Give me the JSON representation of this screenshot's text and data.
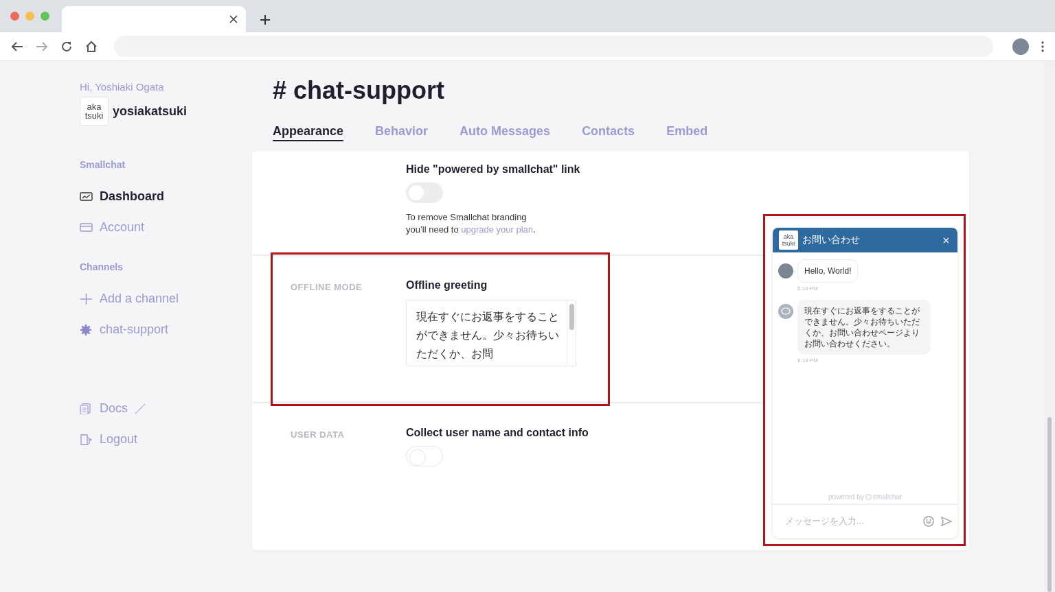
{
  "sidebar": {
    "greeting": "Hi, Yoshiaki Ogata",
    "logo_lines": [
      "aka",
      "tsuki"
    ],
    "workspace": "yosiakatsuki",
    "sections": [
      {
        "heading": "Smallchat",
        "items": [
          {
            "label": "Dashboard",
            "kind": "dashboard",
            "selected": true
          },
          {
            "label": "Account",
            "kind": "account",
            "selected": false
          }
        ]
      },
      {
        "heading": "Channels",
        "items": [
          {
            "label": "Add a channel",
            "kind": "add",
            "selected": false
          },
          {
            "label": "chat-support",
            "kind": "channel",
            "selected": false
          }
        ]
      },
      {
        "items": [
          {
            "label": "Docs",
            "kind": "docs",
            "selected": false
          },
          {
            "label": "Logout",
            "kind": "logout",
            "selected": false
          }
        ]
      }
    ]
  },
  "page": {
    "title": "# chat-support",
    "tabs": [
      {
        "label": "Appearance",
        "selected": true
      },
      {
        "label": "Behavior",
        "selected": false
      },
      {
        "label": "Auto Messages",
        "selected": false
      },
      {
        "label": "Contacts",
        "selected": false
      },
      {
        "label": "Embed",
        "selected": false
      }
    ]
  },
  "settings": [
    {
      "kind": "toggle",
      "title": "Hide \"powered by smallchat\" link",
      "on": false,
      "note": "To remove Smallchat branding you’ll need to",
      "note_link": "upgrade your plan",
      "note_end": "."
    },
    {
      "kind": "textarea",
      "section": "OFFLINE MODE",
      "title": "Offline greeting",
      "value": "現在すぐにお返事をすることができません。少々お待ちいただくか、お問"
    },
    {
      "kind": "toggle",
      "section": "USER DATA",
      "title": "Collect user name and contact info",
      "on": false
    }
  ],
  "chat_preview": {
    "title": "お問い合わせ",
    "logo_lines": [
      "aka",
      "tsuki"
    ],
    "messages": [
      {
        "kind": "user",
        "text": "Hello, World!",
        "time": "6:14 PM"
      },
      {
        "kind": "bot",
        "text": "現在すぐにお返事をすることができません。少々お待ちいただくか、お問い合わせページよりお問い合わせください。",
        "time": "6:14 PM"
      }
    ],
    "powered_by": "powered by",
    "brand": "smallchat",
    "input": {
      "placeholder": "メッセージを入力..."
    }
  }
}
